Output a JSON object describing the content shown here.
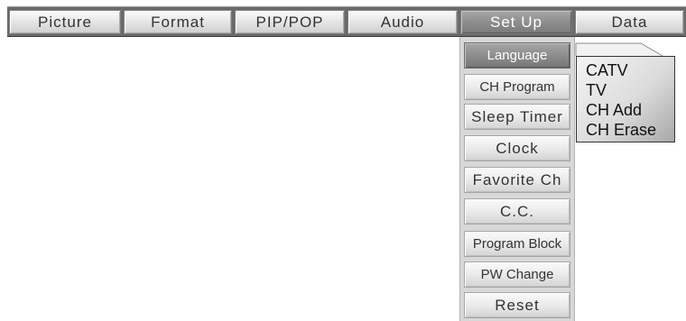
{
  "menu_tabs": [
    {
      "label": "Picture"
    },
    {
      "label": "Format"
    },
    {
      "label": "PIP/POP"
    },
    {
      "label": "Audio"
    },
    {
      "label": "Set Up",
      "active": true
    },
    {
      "label": "Data"
    }
  ],
  "setup_menu": {
    "items": [
      {
        "label": "Language",
        "active": true
      },
      {
        "label": "CH Program"
      },
      {
        "label": "Sleep Timer"
      },
      {
        "label": "Clock"
      },
      {
        "label": "Favorite Ch"
      },
      {
        "label": "C.C."
      },
      {
        "label": "Program Block"
      },
      {
        "label": "PW Change"
      },
      {
        "label": "Reset"
      }
    ]
  },
  "submenu": {
    "items": [
      {
        "label": "CATV"
      },
      {
        "label": "TV"
      },
      {
        "label": "CH Add"
      },
      {
        "label": "CH Erase"
      }
    ]
  }
}
